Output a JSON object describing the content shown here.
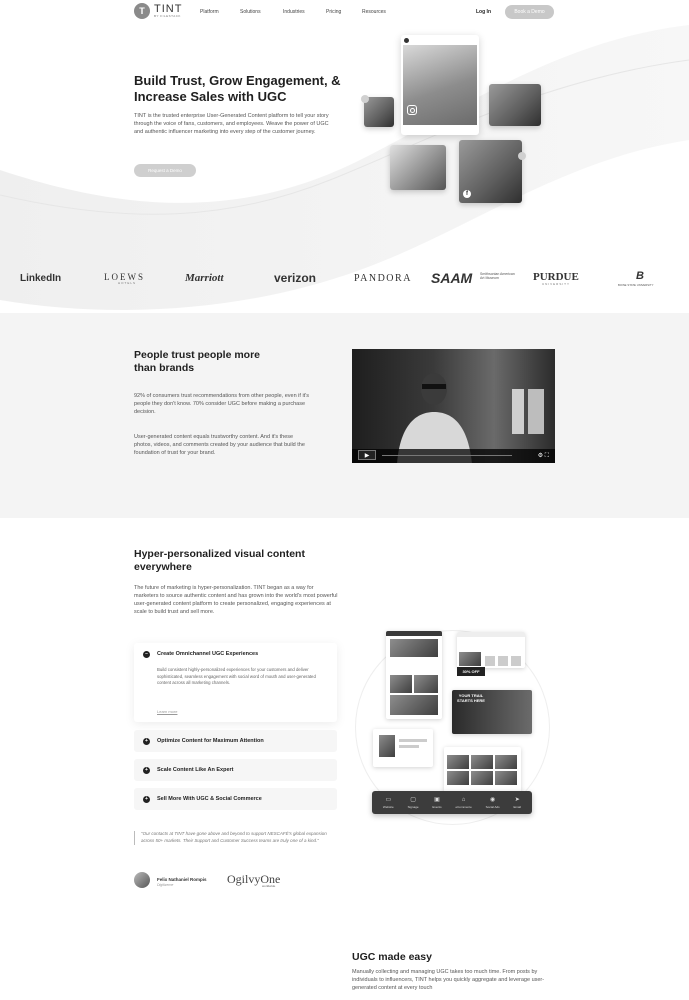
{
  "nav": {
    "logo_mark": "T",
    "logo_name": "TINT",
    "logo_sub": "BY FILESTACK",
    "links": [
      "Platform",
      "Solutions",
      "Industries",
      "Pricing",
      "Resources"
    ],
    "login": "Log In",
    "cta": "Book a Demo"
  },
  "hero": {
    "title": "Build Trust, Grow Engagement, & Increase Sales with UGC",
    "body": "TINT is the trusted enterprise User-Generated Content platform to tell your story through the voice of fans, customers, and employees. Weave the power of UGC and authentic influencer marketing into every step of the customer journey.",
    "cta": "Request a Demo",
    "fb_glyph": "f"
  },
  "clients": [
    "LinkedIn",
    "LOEWS",
    "Marriott",
    "verizon",
    "PANDORA",
    "SAAM",
    "Smithsonian American Art Museum",
    "PURDUE",
    "UNIVERSITY",
    "B",
    "BOISE STATE UNIVERSITY",
    "HOTELS"
  ],
  "trust": {
    "title": "People trust people more than brands",
    "p1": "92% of consumers trust recommendations from other people, even if it's people they don't know. 70% consider UGC before making a purchase decision.",
    "p2": "User-generated content equals trustworthy content. And it's these photos, videos, and comments created by your audience that build the foundation of trust for your brand.",
    "play_glyph": "▶",
    "controls_glyph": "⚙ ⛶"
  },
  "hyper": {
    "title": "Hyper-personalized visual content everywhere",
    "body": "The future of marketing is hyper-personalization. TINT began as a way for marketers to source authentic content and has grown into the world's most powerful user-generated content platform to create personalized, engaging experiences at scale to build trust and sell more.",
    "accordion": [
      {
        "label": "Create Omnichannel UGC Experiences",
        "body": "Build consistent highly-personalized experiences for your customers and deliver sophisticated, seamless engagement with social word of mouth and user-generated content across all marketing channels.",
        "link": "Learn more",
        "icon": "–"
      },
      {
        "label": "Optimize Content for Maximum Attention",
        "icon": "+"
      },
      {
        "label": "Scale Content Like An Expert",
        "icon": "+"
      },
      {
        "label": "Sell More With UGC & Social Commerce",
        "icon": "+"
      }
    ],
    "quote": "\"Our contacts at TINT have gone above and beyond to support NESCAFÉ's global expansion across 50+ markets. Their Support and Customer Success teams are truly one of a kind.\"",
    "testimonial_name": "Felix Nathaniel Rompis",
    "testimonial_role": "Digitizeme",
    "partner_logo": "OgilvyOne",
    "partner_sub": "worldwide"
  },
  "channels": {
    "promo": "30% OFF",
    "trail_text": "YOUR TRAIL STARTS HERE",
    "items": [
      {
        "label": "Website",
        "glyph": "▭"
      },
      {
        "label": "Signage",
        "glyph": "▢"
      },
      {
        "label": "Events",
        "glyph": "▣"
      },
      {
        "label": "eCommerce",
        "glyph": "⌂"
      },
      {
        "label": "Social Ads",
        "glyph": "◉"
      },
      {
        "label": "Email",
        "glyph": "➤"
      }
    ]
  },
  "ugc": {
    "title": "UGC made easy",
    "body": "Manually collecting and managing UGC takes too much time. From posts by individuals to influencers, TINT helps you quickly aggregate and leverage user-generated content at every touch"
  }
}
